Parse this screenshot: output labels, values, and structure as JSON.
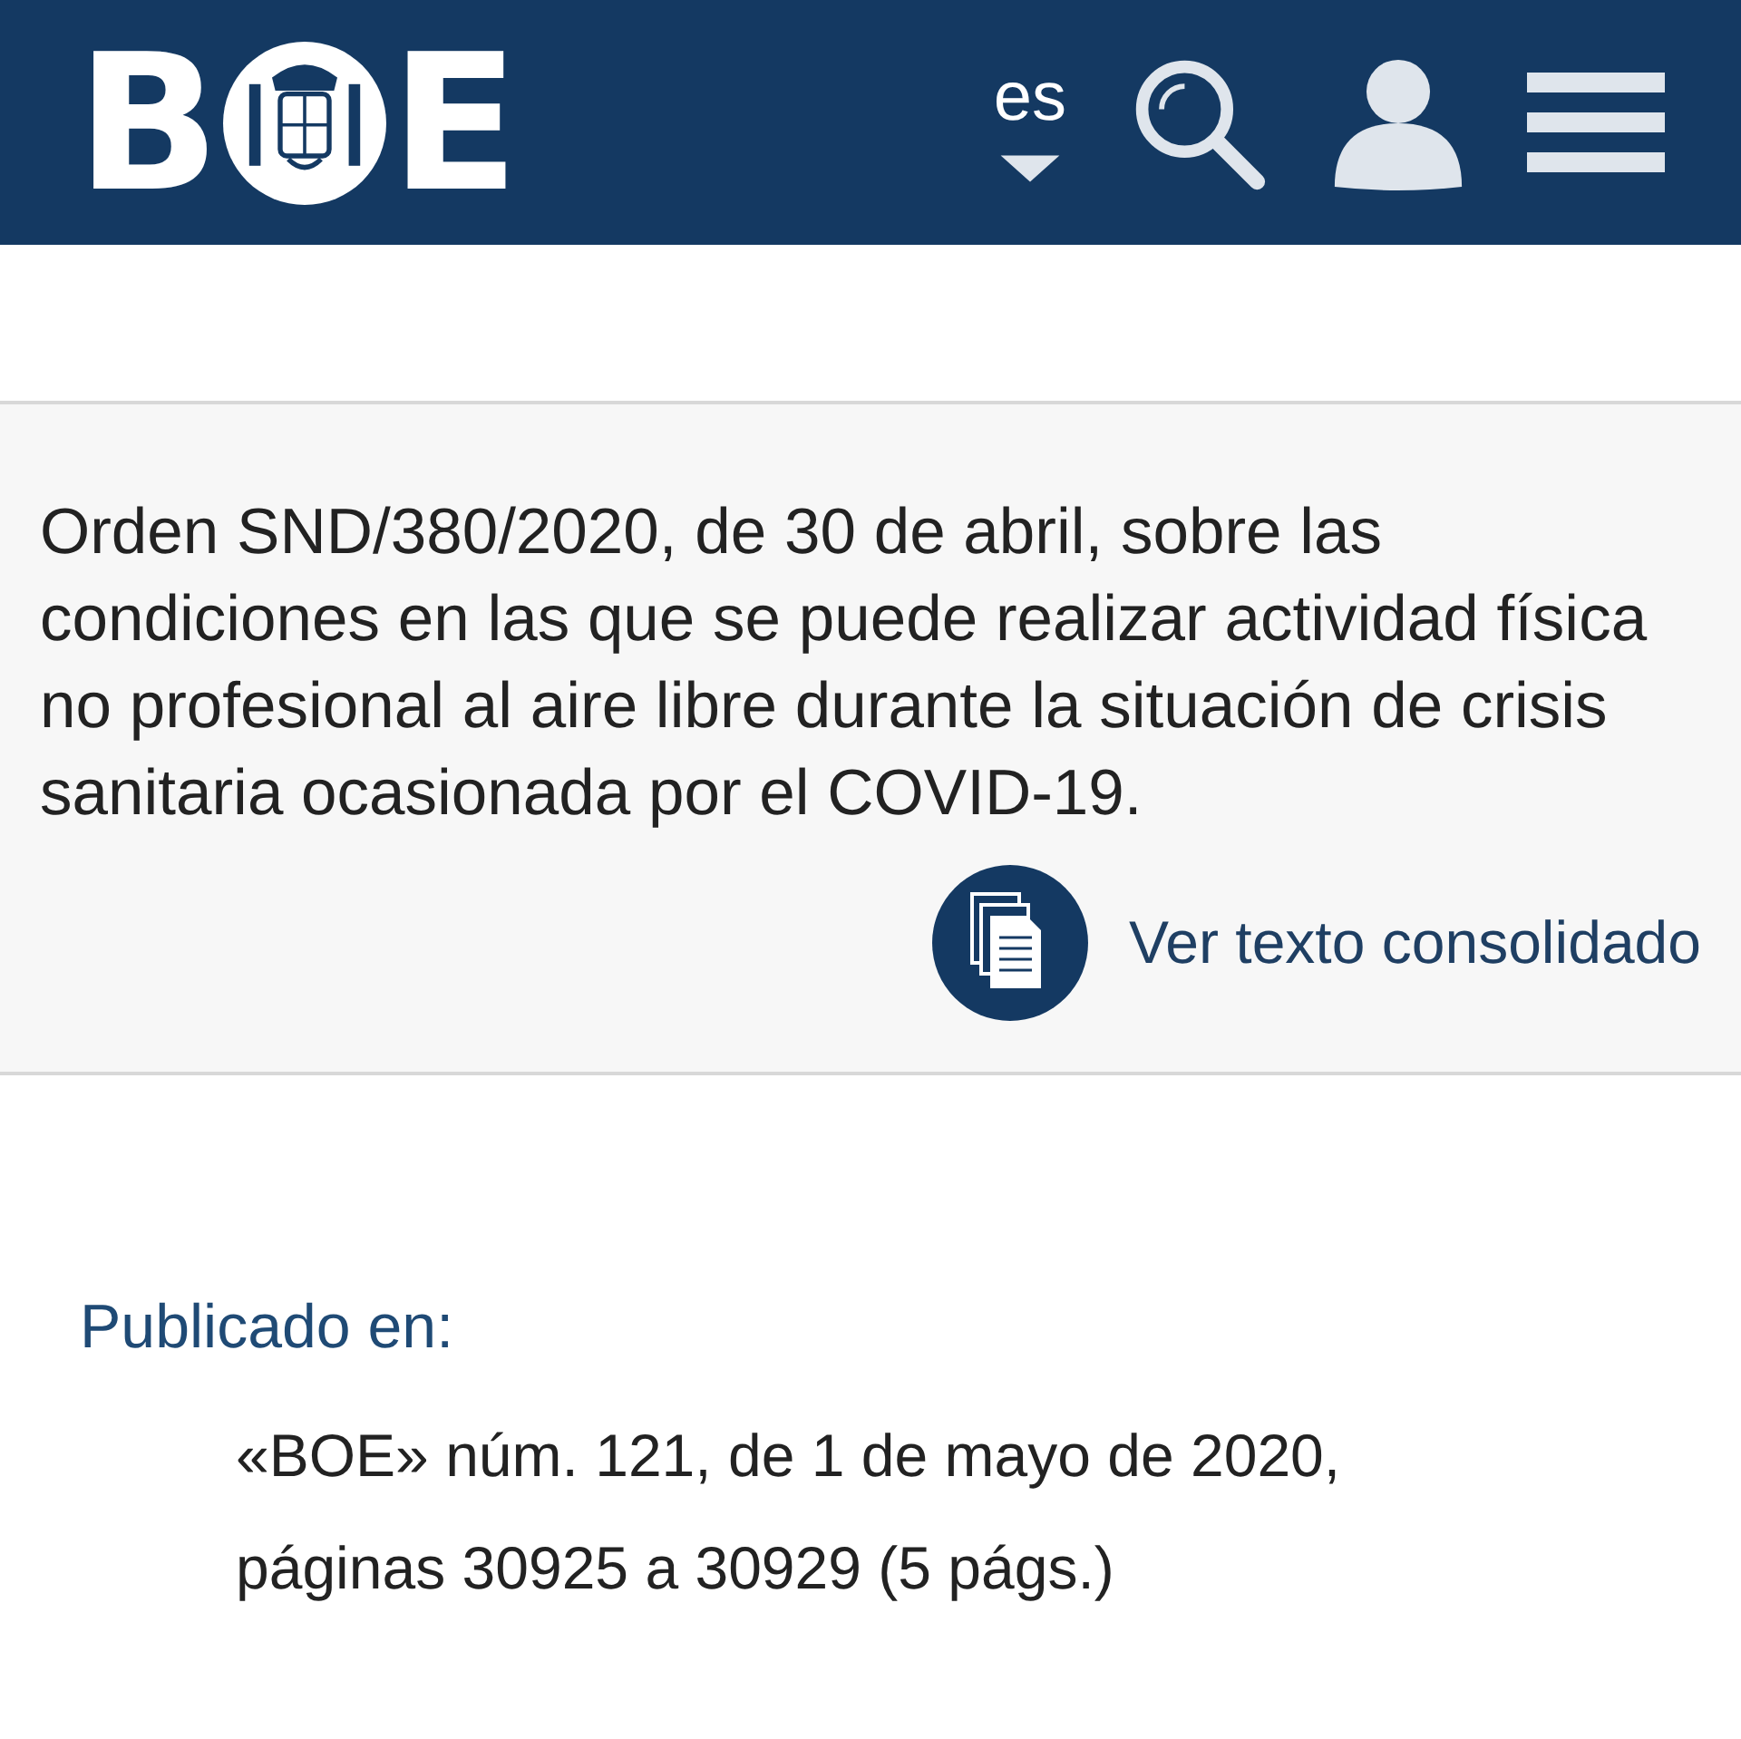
{
  "header": {
    "logo": {
      "letters": [
        "B",
        "E"
      ]
    },
    "language": "es"
  },
  "document": {
    "title": "Orden SND/380/2020, de 30 de abril, sobre las condiciones en las que se puede realizar actividad física no profesional al aire libre durante la situación de crisis sanitaria ocasionada por el COVID-19.",
    "link": "Ver texto consolidado"
  },
  "publication": {
    "label": "Publicado en:",
    "lines": [
      "«BOE» núm. 121, de 1 de mayo de 2020,",
      "páginas 30925 a 30929 (5 págs.)"
    ]
  }
}
